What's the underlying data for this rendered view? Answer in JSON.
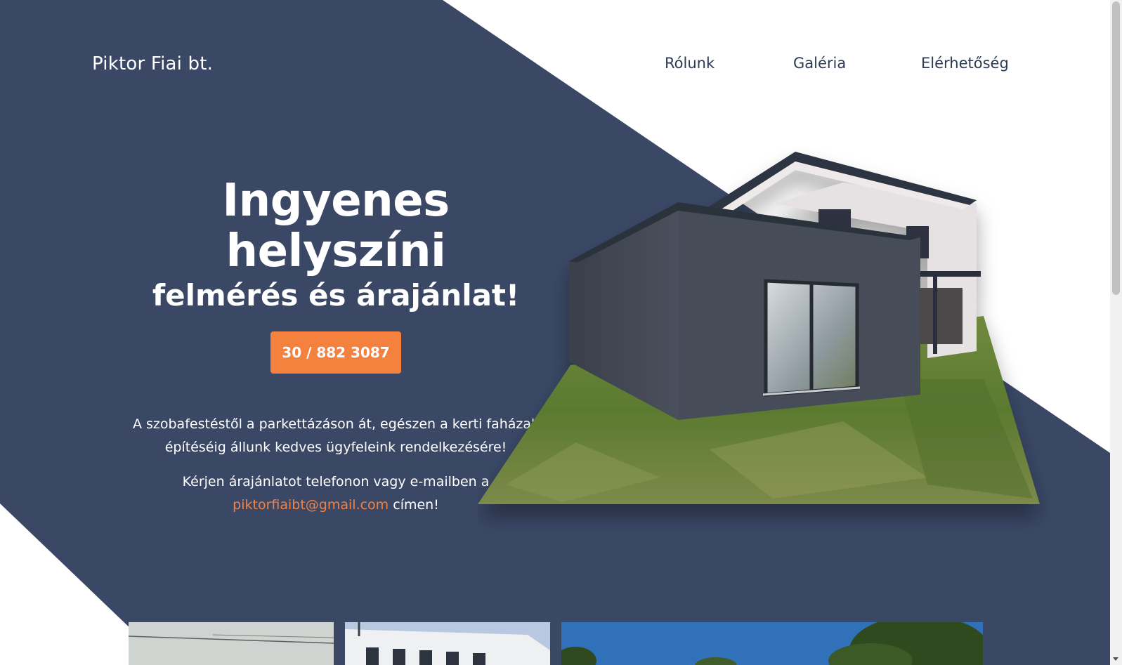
{
  "brand": {
    "name": "Piktor Fiai bt."
  },
  "nav": {
    "items": [
      {
        "label": "Rólunk"
      },
      {
        "label": "Galéria"
      },
      {
        "label": "Elérhetőség"
      }
    ]
  },
  "hero": {
    "headline": "Ingyenes helyszíni",
    "subheadline": "felmérés és árajánlat!",
    "phone_button": "30 / 882 3087",
    "description_line1": "A szobafestéstől a parkettázáson át, egészen a kerti faházak",
    "description_line2": "építéséig állunk kedves ügyfeleink rendelkezésére!",
    "contact_line1": "Kérjen árajánlatot telefonon vagy e-mailben a",
    "email": "piktorfiaibt@gmail.com",
    "contact_suffix": " címen!"
  },
  "colors": {
    "navy": "#3a4866",
    "accent": "#f5813f",
    "white": "#ffffff",
    "nav_text": "#2c3a52"
  }
}
